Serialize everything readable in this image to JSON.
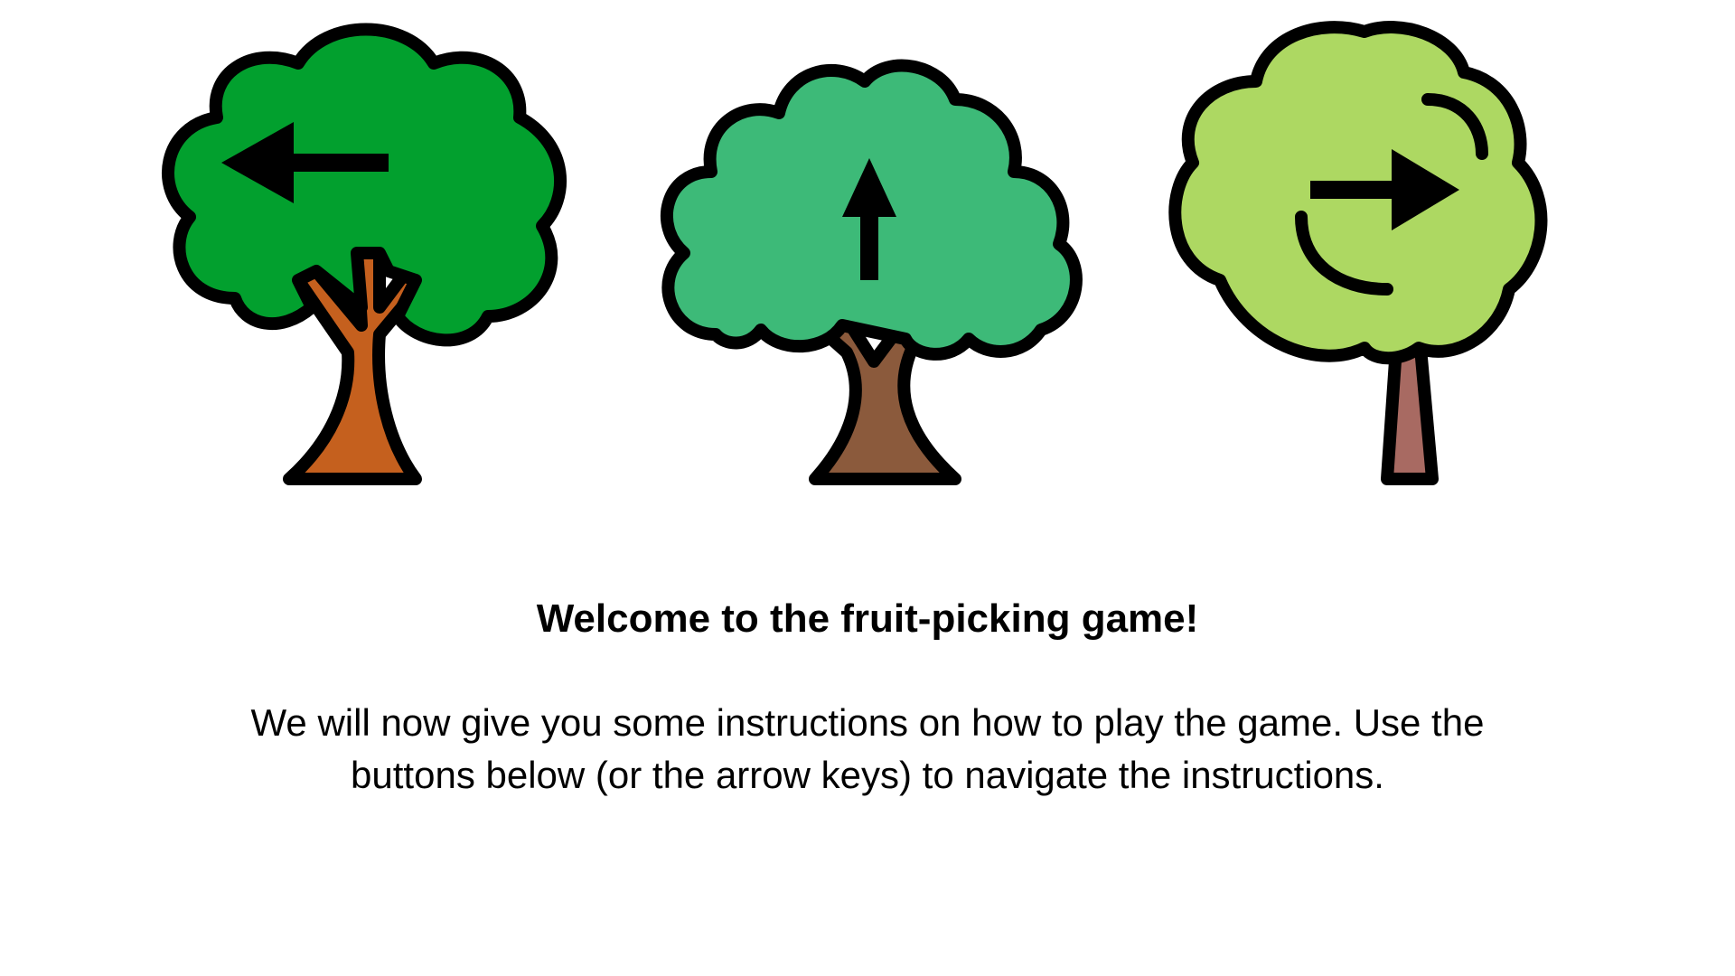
{
  "trees": [
    {
      "id": "left",
      "direction": "left",
      "icon": "left-arrow-icon",
      "leaf_color": "#02A02E",
      "leaf_shade": "#028425",
      "trunk_color": "#C5601E",
      "trunk_shade": "#A24E18"
    },
    {
      "id": "middle",
      "direction": "up",
      "icon": "up-arrow-icon",
      "leaf_color": "#3DBA78",
      "leaf_shade": "#11B36E",
      "trunk_color": "#8B5A3C",
      "trunk_shade": "#754A30"
    },
    {
      "id": "right",
      "direction": "right",
      "icon": "right-arrow-icon",
      "leaf_color": "#ADD862",
      "leaf_shade": "#93BF55",
      "trunk_color": "#A86A62",
      "trunk_shade": "#8E544D"
    }
  ],
  "instructions": {
    "title": "Welcome to the fruit-picking game!",
    "body": "We will now give you some instructions on how to play the game. Use the buttons below (or the arrow keys) to navigate the instructions."
  },
  "colors": {
    "outline": "#000000",
    "background": "#FFFFFF"
  }
}
